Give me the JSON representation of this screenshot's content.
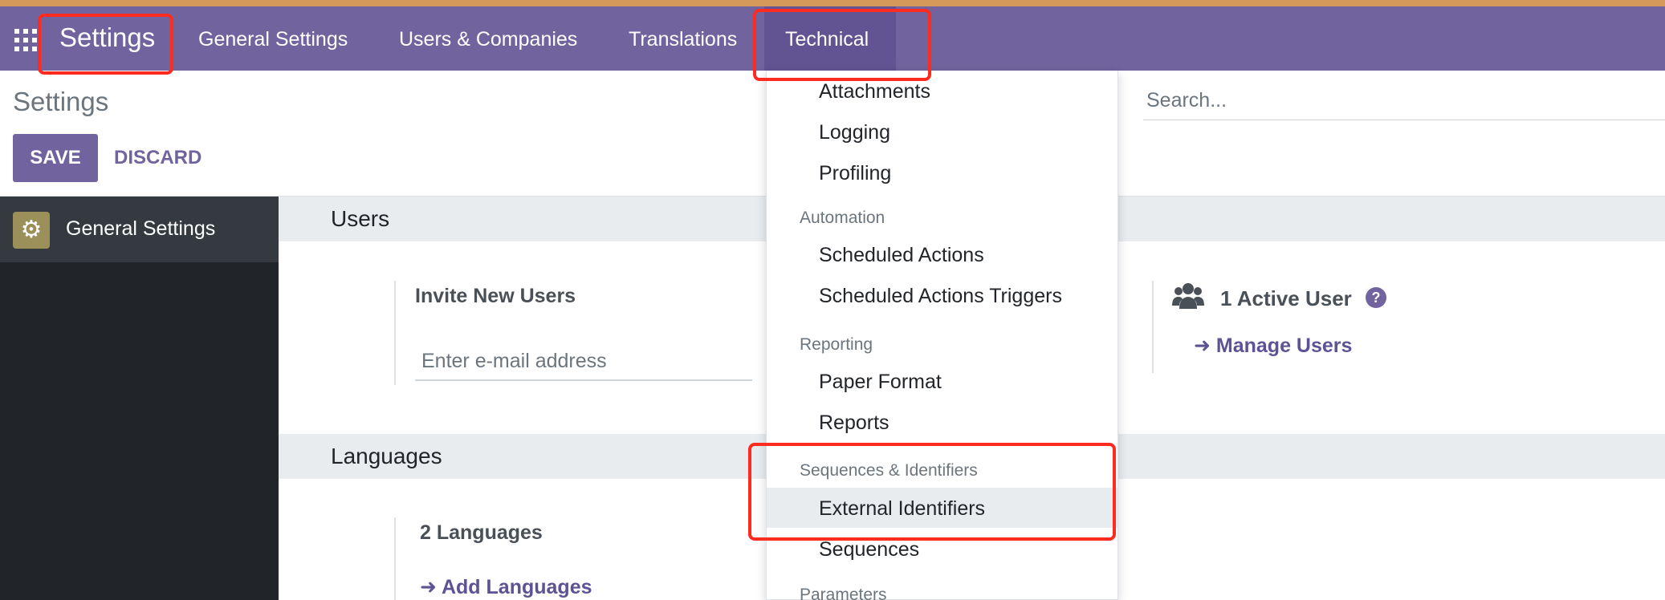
{
  "navbar": {
    "brand": "Settings",
    "menu": [
      "General Settings",
      "Users & Companies",
      "Translations",
      "Technical"
    ]
  },
  "control_panel": {
    "title": "Settings",
    "save_label": "SAVE",
    "discard_label": "DISCARD",
    "search_placeholder": "Search..."
  },
  "sidebar": {
    "items": [
      {
        "label": "General Settings",
        "icon": "gear-icon"
      }
    ]
  },
  "users_section": {
    "header": "Users",
    "invite_label": "Invite New Users",
    "email_placeholder": "Enter e-mail address",
    "active_users": "1 Active User",
    "help": "?",
    "manage_users_link": "Manage Users"
  },
  "languages_section": {
    "header": "Languages",
    "count_label": "2 Languages",
    "add_link": "Add Languages"
  },
  "technical_menu": {
    "items": [
      "Attachments",
      "Logging",
      "Profiling"
    ],
    "groups": [
      {
        "header": "Automation",
        "items": [
          "Scheduled Actions",
          "Scheduled Actions Triggers"
        ]
      },
      {
        "header": "Reporting",
        "items": [
          "Paper Format",
          "Reports"
        ]
      },
      {
        "header": "Sequences & Identifiers",
        "items": [
          "External Identifiers",
          "Sequences"
        ]
      },
      {
        "header": "Parameters",
        "items": []
      }
    ],
    "highlighted_item": "External Identifiers"
  },
  "colors": {
    "navbar": "#71639e",
    "accent": "#5e5295",
    "top_strip": "#d59a59",
    "highlight_box": "#ff2a20",
    "sidebar": "#212529"
  }
}
